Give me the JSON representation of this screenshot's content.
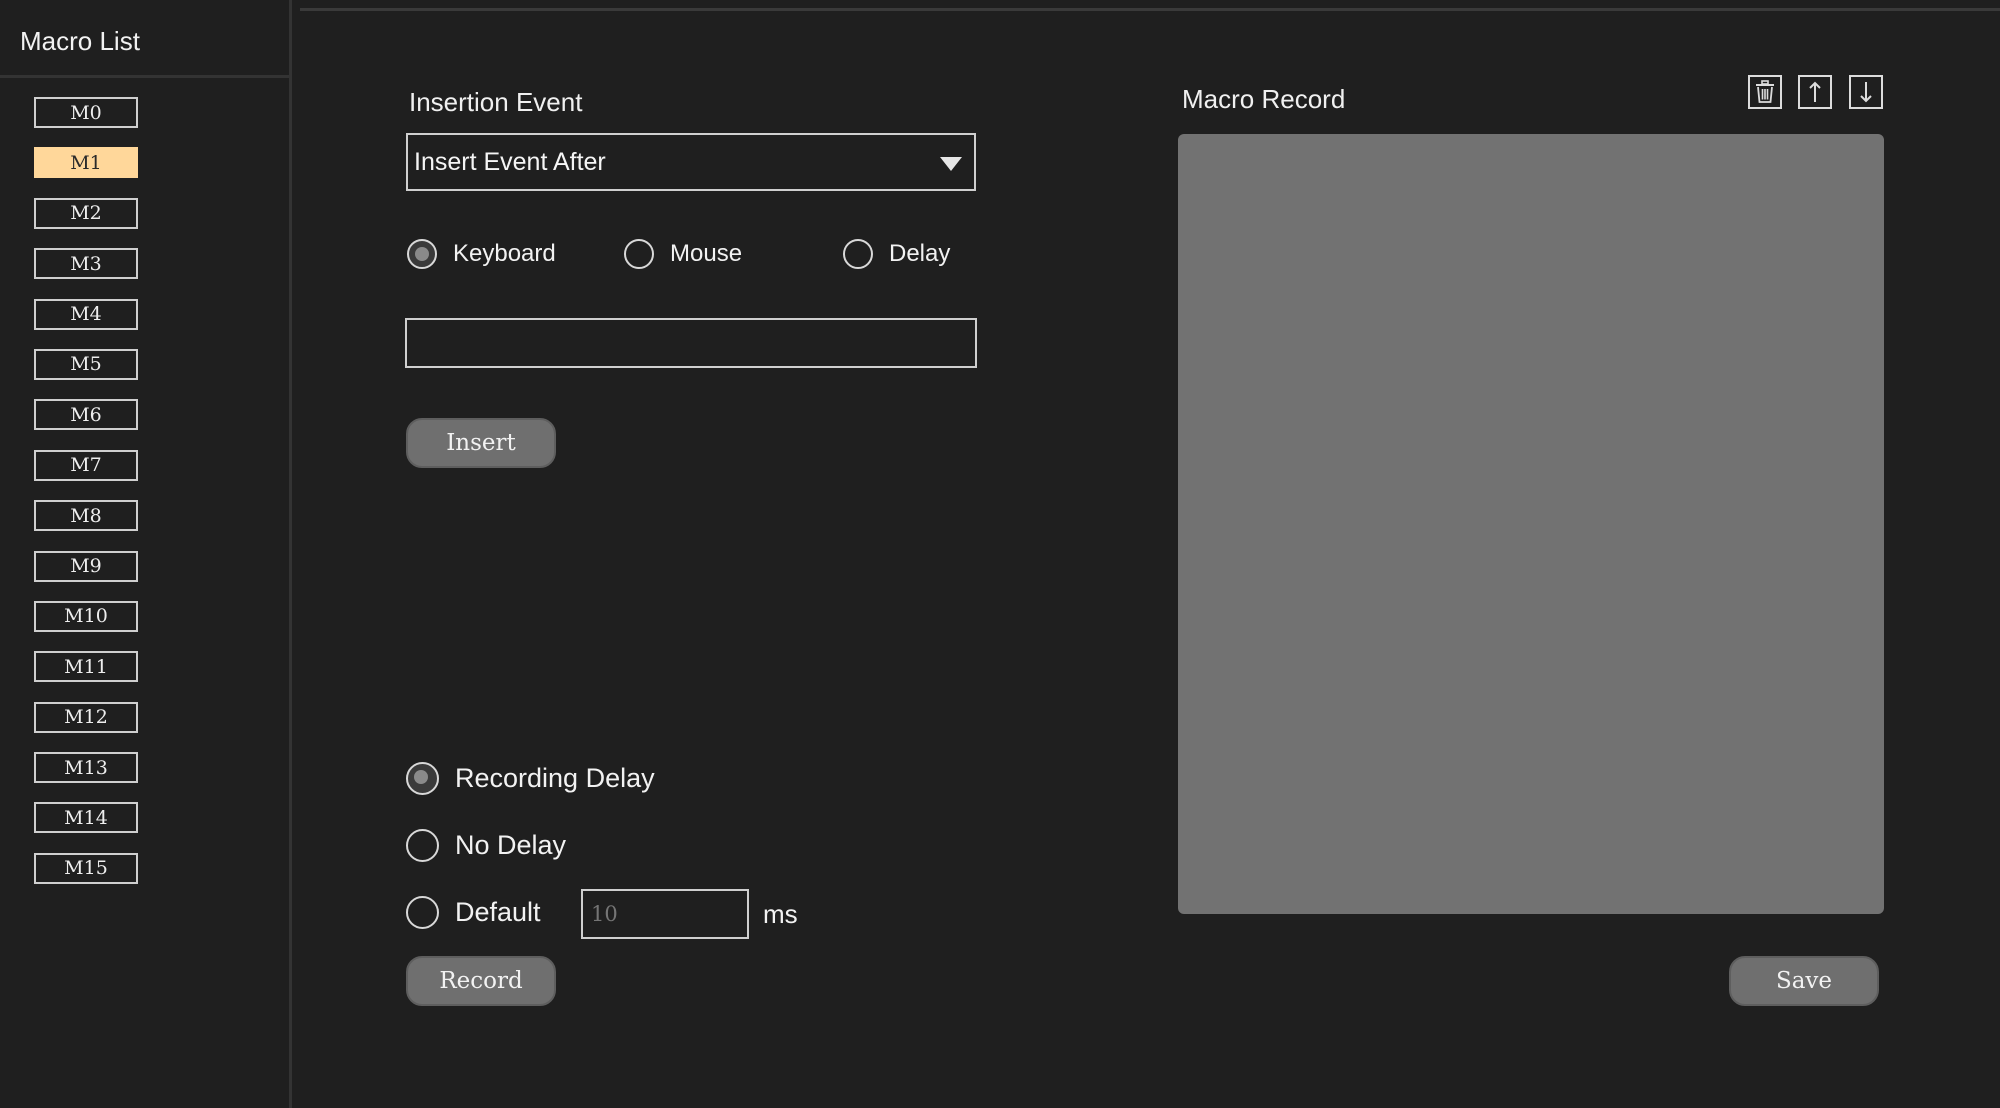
{
  "sidebar": {
    "title": "Macro List",
    "selected_index": 1,
    "items": [
      "M0",
      "M1",
      "M2",
      "M3",
      "M4",
      "M5",
      "M6",
      "M7",
      "M8",
      "M9",
      "M10",
      "M11",
      "M12",
      "M13",
      "M14",
      "M15"
    ]
  },
  "insertion": {
    "title": "Insertion Event",
    "dropdown_value": "Insert Event After",
    "event_types": [
      {
        "label": "Keyboard",
        "checked": true
      },
      {
        "label": "Mouse",
        "checked": false
      },
      {
        "label": "Delay",
        "checked": false
      }
    ],
    "event_value": "",
    "insert_label": "Insert"
  },
  "recording": {
    "options": [
      {
        "label": "Recording Delay",
        "checked": true
      },
      {
        "label": "No Delay",
        "checked": false
      },
      {
        "label": "Default",
        "checked": false
      }
    ],
    "default_delay_placeholder": "10",
    "unit": "ms",
    "record_label": "Record"
  },
  "macro_record": {
    "title": "Macro Record",
    "icons": [
      "trash-icon",
      "arrow-up-icon",
      "arrow-down-icon"
    ],
    "save_label": "Save"
  },
  "colors": {
    "background": "#1f1f1f",
    "selected_item": "#ffd79a",
    "record_panel": "#727272",
    "button": "#6f6f6f"
  }
}
